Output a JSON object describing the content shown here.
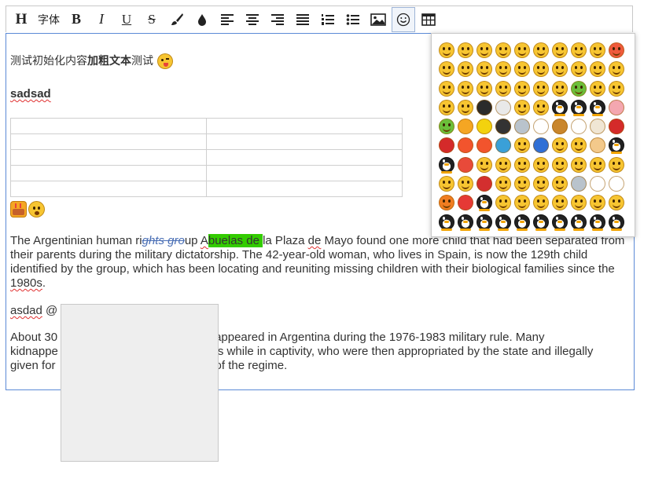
{
  "toolbar": {
    "heading_label": "H",
    "font_label": "字体",
    "bold_label": "B",
    "italic_label": "I",
    "underline_label": "U",
    "strike_label": "S"
  },
  "editor": {
    "line1_normal_a": "测试初始化内容",
    "line1_bold": "加粗文本",
    "line1_normal_b": "测试",
    "line2": "sadsad",
    "table_rows": 5,
    "table_cols": 2,
    "para1": {
      "a": "The Argentinian human ri",
      "strike": "ghts gro",
      "b": "up ",
      "c": "A",
      "highlight": "buelas de ",
      "d": "la Plaza ",
      "de": "de",
      "e": " Mayo found one more child that had been separated from their parents during the military dictatorship. The 42-year-old woman, who lives in Spain, is now the 129th child identified by the group, which has been locating and reuniting missing children with their biological families since the ",
      "year": "1980s",
      "end": "."
    },
    "line_asdad": {
      "word": "asdad",
      "rest": " @"
    },
    "para2": {
      "l1a": "About 30",
      "l1b": "appeared in Argentina during the 1976-1983 military rule. Many",
      "l2a": "kidnappe",
      "l2b": "s while in captivity, who were then appropriated by the state and illegally",
      "l3a": "given for",
      "l3b": "of the regime."
    }
  },
  "colors": {
    "editor_border": "#5b8ad6",
    "highlight": "#33cc00",
    "emoji_yellow": "#f7c531",
    "spell_error": "#e03030"
  },
  "emoji_panel": {
    "rows": [
      [
        "yellow",
        "yellow",
        "yellow",
        "yellow",
        "yellow",
        "yellow",
        "yellow",
        "yellow",
        "yellow",
        "red"
      ],
      [
        "yellow",
        "yellow",
        "yellow",
        "yellow",
        "yellow",
        "yellow",
        "yellow",
        "yellow",
        "yellow",
        "yellow"
      ],
      [
        "yellow",
        "yellow",
        "yellow",
        "yellow",
        "yellow",
        "yellow",
        "yellow",
        "green",
        "yellow",
        "yellow"
      ],
      [
        "yellow",
        "yellow",
        "black",
        "skull",
        "yellow",
        "yellow",
        "qq",
        "qq",
        "qq",
        "pig"
      ],
      [
        "green",
        "cake",
        "bolt",
        "bomb",
        "knife",
        "ball",
        "poop",
        "cup",
        "bowl",
        "rose"
      ],
      [
        "rose",
        "heart",
        "heart",
        "gift",
        "yellow",
        "moon",
        "thumb",
        "thumb",
        "hands",
        "qq"
      ],
      [
        "qq",
        "melon",
        "yellow",
        "yellow",
        "yellow",
        "yellow",
        "yellow",
        "yellow",
        "yellow",
        "yellow"
      ],
      [
        "yellow",
        "yellow",
        "bug",
        "yellow",
        "yellow",
        "yellow",
        "yellow",
        "knife",
        "cup",
        "ball"
      ],
      [
        "orange",
        "lips",
        "qq",
        "yellow",
        "yellow",
        "yellow",
        "yellow",
        "yellow",
        "yellow",
        "yellow"
      ],
      [
        "qq",
        "qq",
        "qq",
        "qq",
        "qq",
        "qq",
        "qq",
        "qq",
        "qq",
        "qq"
      ]
    ]
  },
  "inline_emojis": [
    "cake",
    "yellow"
  ]
}
